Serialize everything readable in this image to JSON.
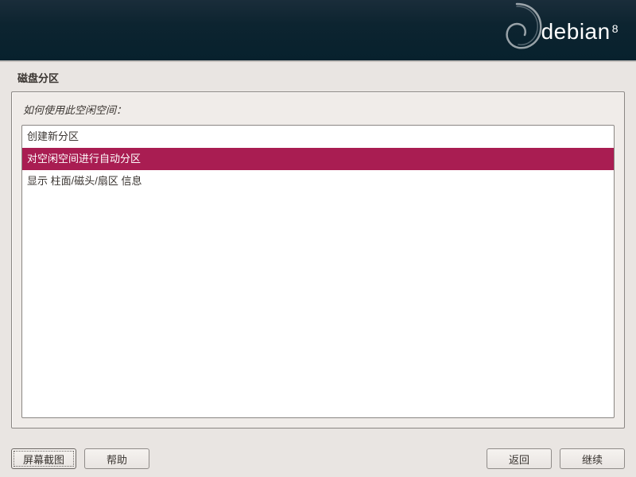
{
  "brand": {
    "name": "debian",
    "version": "8"
  },
  "page": {
    "title": "磁盘分区"
  },
  "prompt": "如何使用此空闲空间：",
  "options": [
    {
      "label": "创建新分区",
      "selected": false
    },
    {
      "label": "对空闲空间进行自动分区",
      "selected": true
    },
    {
      "label": "显示 柱面/磁头/扇区 信息",
      "selected": false
    }
  ],
  "buttons": {
    "screenshot": "屏幕截图",
    "help": "帮助",
    "back": "返回",
    "continue": "继续"
  }
}
